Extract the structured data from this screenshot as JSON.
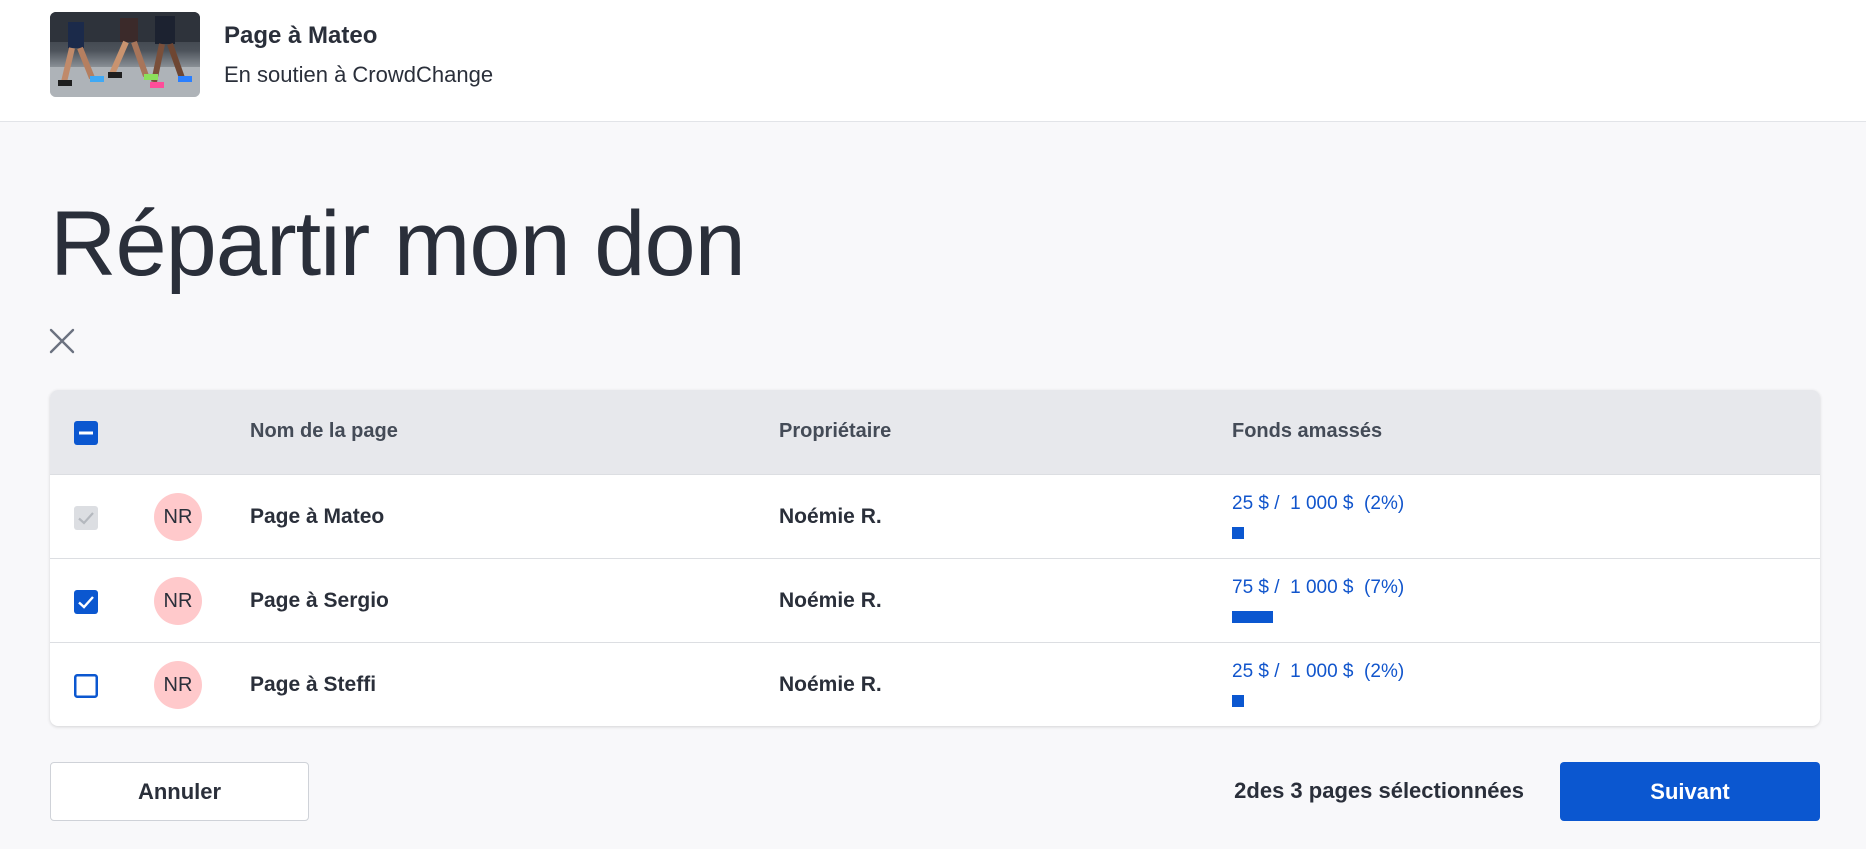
{
  "header": {
    "title": "Page à Mateo",
    "subtitle": "En soutien à CrowdChange"
  },
  "page_title": "Répartir mon don",
  "table": {
    "columns": [
      "Nom de la page",
      "Propriétaire",
      "Fonds amassés"
    ],
    "header_checkbox_state": "indeterminate",
    "rows": [
      {
        "checkbox_state": "checked-disabled",
        "avatar": "NR",
        "name": "Page à Mateo",
        "owner": "Noémie R.",
        "funds": "25 $ /  1 000 $  (2%)",
        "progress_percent": 2
      },
      {
        "checkbox_state": "checked",
        "avatar": "NR",
        "name": "Page à Sergio",
        "owner": "Noémie R.",
        "funds": "75 $ /  1 000 $  (7%)",
        "progress_percent": 7
      },
      {
        "checkbox_state": "unchecked",
        "avatar": "NR",
        "name": "Page à Steffi",
        "owner": "Noémie R.",
        "funds": "25 $ /  1 000 $  (2%)",
        "progress_percent": 2
      }
    ]
  },
  "footer": {
    "cancel_label": "Annuler",
    "selection_text": "2des 3 pages sélectionnées",
    "next_label": "Suivant"
  },
  "icons": {
    "close": "close-icon",
    "checkbox_checked": "checkbox-checked-icon",
    "checkbox_unchecked": "checkbox-unchecked-icon",
    "checkbox_indeterminate": "checkbox-indeterminate-icon"
  },
  "colors": {
    "primary": "#0b57d0",
    "link": "#1155cc",
    "avatar_bg": "#ffc9cb",
    "table_header_bg": "#e7e8ec",
    "disabled_checkbox": "#d9dbdf"
  }
}
